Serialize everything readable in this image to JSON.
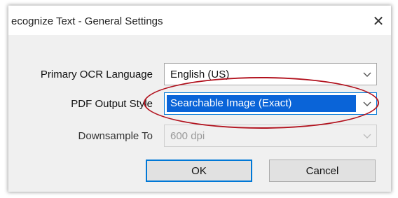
{
  "window": {
    "title": "ecognize Text - General Settings",
    "close_icon": "close-icon"
  },
  "fields": [
    {
      "label": "Primary OCR Language",
      "value": "English (US)",
      "state": "normal"
    },
    {
      "label": "PDF Output Style",
      "value": "Searchable Image (Exact)",
      "state": "selected"
    },
    {
      "label": "Downsample To",
      "value": "600 dpi",
      "state": "disabled"
    }
  ],
  "buttons": {
    "ok": "OK",
    "cancel": "Cancel"
  },
  "colors": {
    "selection": "#0a64d8",
    "annotation_ellipse": "#b2121e"
  }
}
